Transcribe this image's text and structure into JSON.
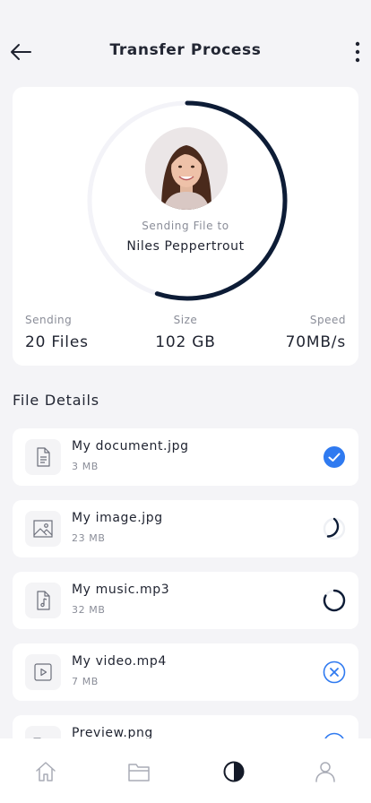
{
  "header": {
    "title": "Transfer Process",
    "back_icon": "arrow-left-icon",
    "menu_icon": "more-vertical-icon"
  },
  "transfer": {
    "sending_label": "Sending File to",
    "recipient": "Niles Peppertrout",
    "progress": 0.55,
    "stats": [
      {
        "label": "Sending",
        "value": "20 Files"
      },
      {
        "label": "Size",
        "value": "102 GB"
      },
      {
        "label": "Speed",
        "value": "70MB/s"
      }
    ]
  },
  "file_section": {
    "title": "File Details"
  },
  "files": [
    {
      "name": "My document.jpg",
      "size": "3 MB",
      "icon": "document-icon",
      "status": "completed"
    },
    {
      "name": "My image.jpg",
      "size": "23 MB",
      "icon": "image-icon",
      "status": "in-progress"
    },
    {
      "name": "My music.mp3",
      "size": "32 MB",
      "icon": "music-file-icon",
      "status": "loading"
    },
    {
      "name": "My video.mp4",
      "size": "7 MB",
      "icon": "video-file-icon",
      "status": "cancel"
    },
    {
      "name": "Preview.png",
      "size": "",
      "icon": "folder-icon",
      "status": "cancel"
    }
  ],
  "nav": [
    {
      "name": "home-icon"
    },
    {
      "name": "files-icon"
    },
    {
      "name": "pie-chart-icon",
      "active": true
    },
    {
      "name": "profile-icon"
    }
  ],
  "colors": {
    "accent": "#2f7af0",
    "ring": "#0d1c36",
    "background": "#f4f4f7"
  }
}
